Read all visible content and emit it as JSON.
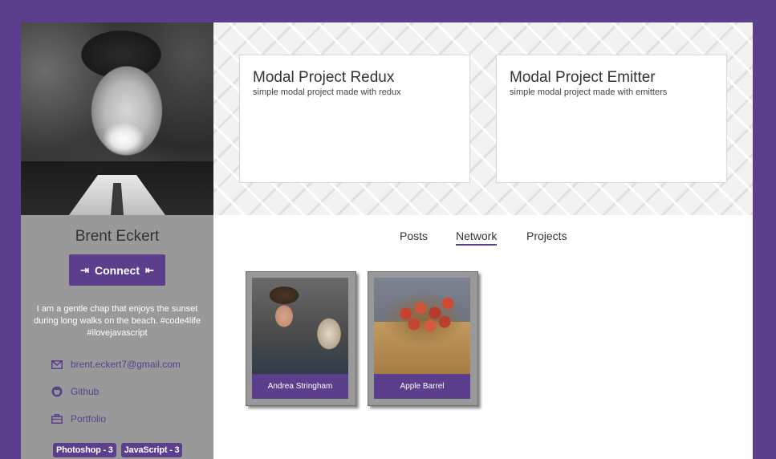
{
  "colors": {
    "accent": "#5b3f8c",
    "sidebar_bg": "#999999",
    "page_bg": "#ffffff"
  },
  "profile": {
    "name": "Brent Eckert",
    "connect_label": "Connect",
    "bio": "I am a gentle chap that enjoys the sunset during long walks on the beach. #code4life #ilovejavascript",
    "contacts": [
      {
        "icon": "mail-icon",
        "label": "brent.eckert7@gmail.com"
      },
      {
        "icon": "github-icon",
        "label": "Github"
      },
      {
        "icon": "briefcase-icon",
        "label": "Portfolio"
      }
    ],
    "skills": [
      "Photoshop - 3",
      "JavaScript - 3"
    ]
  },
  "projects": [
    {
      "title": "Modal Project Redux",
      "description": "simple modal project made with redux"
    },
    {
      "title": "Modal Project Emitter",
      "description": "simple modal project made with emitters"
    }
  ],
  "tabs": [
    {
      "label": "Posts",
      "active": false
    },
    {
      "label": "Network",
      "active": true
    },
    {
      "label": "Projects",
      "active": false
    }
  ],
  "network": [
    {
      "name": "Andrea Stringham"
    },
    {
      "name": "Apple Barrel"
    }
  ]
}
